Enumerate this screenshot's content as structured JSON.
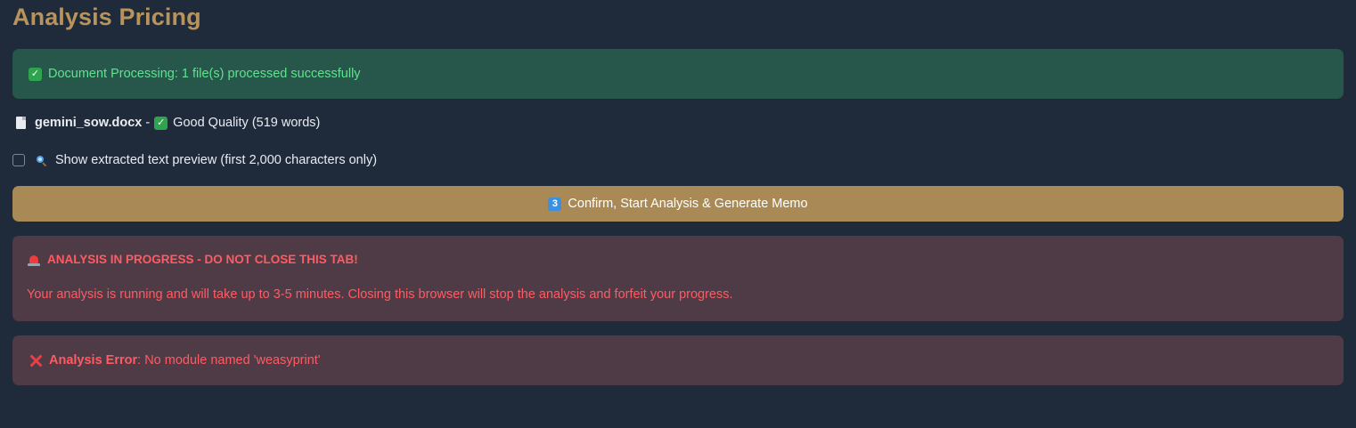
{
  "page": {
    "title": "Analysis Pricing",
    "background_color": "#1f2a3a",
    "accent_color": "#a98a57"
  },
  "processing": {
    "icon": "check-box-icon",
    "message": "Document Processing: 1 file(s) processed successfully",
    "color": "#27564a"
  },
  "file": {
    "icon": "document-icon",
    "name": "gemini_sow.docx",
    "separator": "-",
    "status_icon": "check-box-icon",
    "status": "Good Quality (519 words)"
  },
  "preview": {
    "checked": false,
    "icon": "search-icon",
    "label": "Show extracted text preview (first 2,000 characters only)"
  },
  "action": {
    "icon": "keycap-3-icon",
    "icon_text": "3",
    "label": "Confirm, Start Analysis & Generate Memo"
  },
  "warning": {
    "icon": "siren-icon",
    "title": "ANALYSIS IN PROGRESS - DO NOT CLOSE THIS TAB!",
    "body": "Your analysis is running and will take up to 3-5 minutes. Closing this browser will stop the analysis and forfeit your progress.",
    "color": "#ff5b64"
  },
  "error": {
    "icon": "cross-icon",
    "label": "Analysis Error",
    "message": ": No module named 'weasyprint'"
  }
}
